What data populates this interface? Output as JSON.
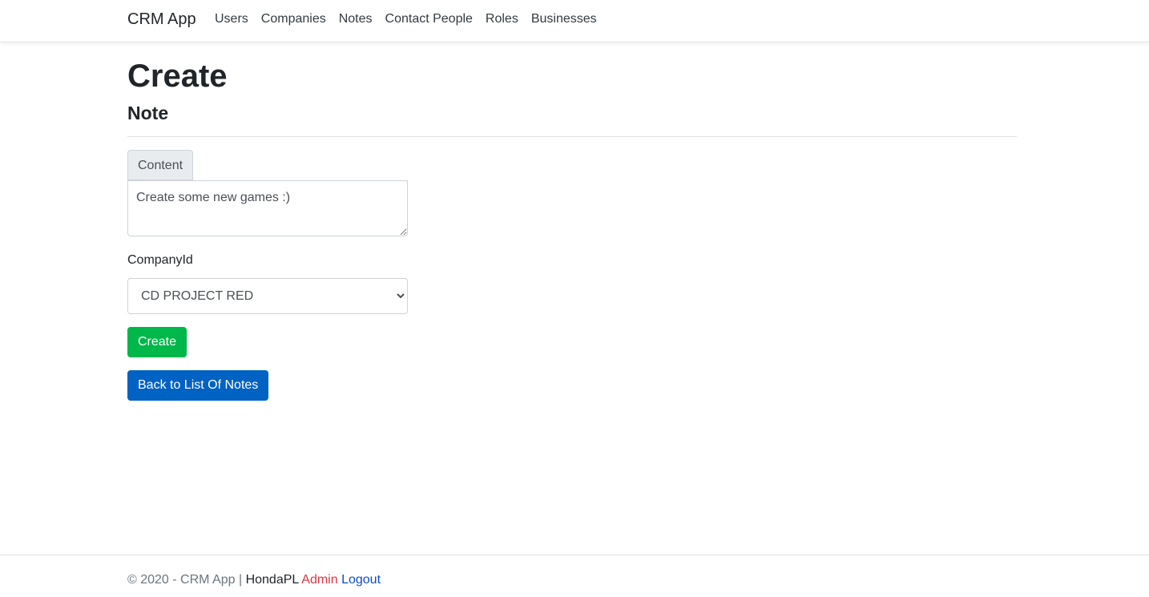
{
  "navbar": {
    "brand": "CRM App",
    "items": [
      "Users",
      "Companies",
      "Notes",
      "Contact People",
      "Roles",
      "Businesses"
    ]
  },
  "page": {
    "title": "Create",
    "subtitle": "Note"
  },
  "form": {
    "content_label": "Content",
    "content_value": "Create some new games :)",
    "company_label": "CompanyId",
    "company_selected": "CD PROJECT RED",
    "create_button": "Create"
  },
  "back_link": "Back to List Of Notes",
  "footer": {
    "copyright": "© 2020 - CRM App |",
    "username": "HondaPL",
    "role": "Admin",
    "logout": "Logout"
  },
  "colors": {
    "create_button": "#00b74a",
    "back_button": "#0062c3",
    "role_text": "#dc3545",
    "logout_link": "#0d4dc0"
  }
}
